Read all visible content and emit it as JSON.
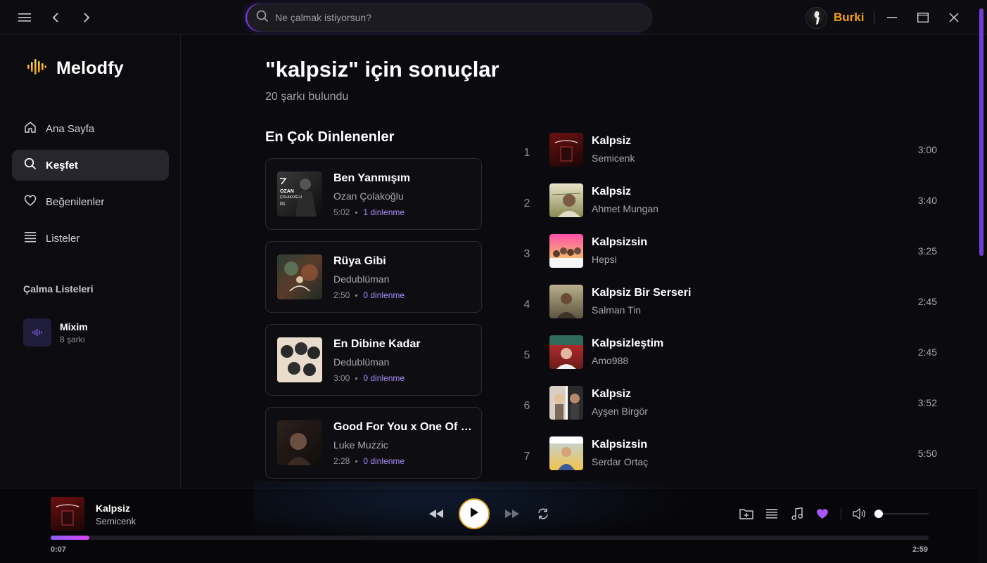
{
  "topbar": {
    "search_placeholder": "Ne çalmak istiyorsun?",
    "username": "Burki"
  },
  "sidebar": {
    "app_name": "Melodfy",
    "nav": [
      {
        "label": "Ana Sayfa",
        "icon": "home-icon"
      },
      {
        "label": "Keşfet",
        "icon": "search-icon",
        "active": true
      },
      {
        "label": "Beğenilenler",
        "icon": "heart-icon"
      },
      {
        "label": "Listeler",
        "icon": "list-icon"
      }
    ],
    "playlists_title": "Çalma Listeleri",
    "playlists": [
      {
        "name": "Mixim",
        "count": "8 şarkı"
      }
    ]
  },
  "main": {
    "title": "\"kalpsiz\" için sonuçlar",
    "subtitle": "20 şarkı bulundu",
    "most_played_title": "En Çok Dinlenenler",
    "most_played": [
      {
        "title": "Ben Yanmışım",
        "artist": "Ozan Çolakoğlu",
        "duration": "5:02",
        "plays": "1 dinlenme"
      },
      {
        "title": "Rüya Gibi",
        "artist": "Dedublüman",
        "duration": "2:50",
        "plays": "0 dinlenme"
      },
      {
        "title": "En Dibine Kadar",
        "artist": "Dedublüman",
        "duration": "3:00",
        "plays": "0 dinlenme"
      },
      {
        "title": "Good For You x One Of The Girls",
        "artist": "Luke Muzzic",
        "duration": "2:28",
        "plays": "0 dinlenme"
      }
    ],
    "results": [
      {
        "num": "1",
        "title": "Kalpsiz",
        "artist": "Semicenk",
        "duration": "3:00"
      },
      {
        "num": "2",
        "title": "Kalpsiz",
        "artist": "Ahmet Mungan",
        "duration": "3:40"
      },
      {
        "num": "3",
        "title": "Kalpsizsin",
        "artist": "Hepsi",
        "duration": "3:25"
      },
      {
        "num": "4",
        "title": "Kalpsiz Bir Serseri",
        "artist": "Salman Tin",
        "duration": "2:45"
      },
      {
        "num": "5",
        "title": "Kalpsizleştim",
        "artist": "Amo988",
        "duration": "2:45"
      },
      {
        "num": "6",
        "title": "Kalpsiz",
        "artist": "Ayşen Birgör",
        "duration": "3:52"
      },
      {
        "num": "7",
        "title": "Kalpsizsin",
        "artist": "Serdar Ortaç",
        "duration": "5:50"
      }
    ]
  },
  "player": {
    "title": "Kalpsiz",
    "artist": "Semicenk",
    "current_time": "0:07",
    "total_time": "2:59",
    "progress_fraction": 0.044,
    "volume_fraction": 0.0,
    "liked": true
  },
  "colors": {
    "accent": "#8b5cf6",
    "username": "#f59e0b",
    "play_ring": "#e0a526",
    "liked_heart": "#a855f7"
  }
}
